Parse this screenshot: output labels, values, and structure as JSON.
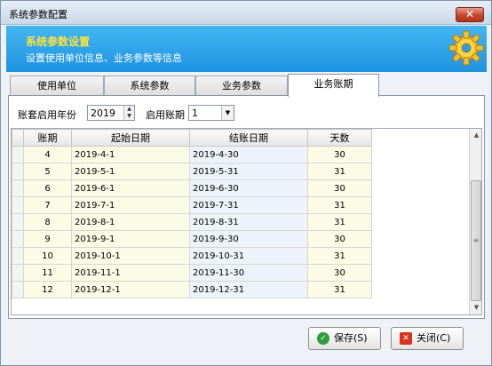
{
  "window": {
    "title": "系统参数配置",
    "close_glyph": "✕"
  },
  "banner": {
    "title": "系统参数设置",
    "subtitle": "设置使用单位信息、业务参数等信息",
    "icon": "gear-icon",
    "colors": {
      "title": "#ffe23b",
      "background": "#1e93e0"
    }
  },
  "tabs": [
    {
      "label": "使用单位",
      "active": false
    },
    {
      "label": "系统参数",
      "active": false
    },
    {
      "label": "业务参数",
      "active": false
    },
    {
      "label": "业务账期",
      "active": true
    }
  ],
  "form": {
    "year_label": "账套启用年份",
    "year_value": "2019",
    "period_label": "启用账期",
    "period_value": "1"
  },
  "grid": {
    "columns": [
      "账期",
      "起始日期",
      "结账日期",
      "天数"
    ],
    "rows": [
      [
        "4",
        "2019-4-1",
        "2019-4-30",
        "30"
      ],
      [
        "5",
        "2019-5-1",
        "2019-5-31",
        "31"
      ],
      [
        "6",
        "2019-6-1",
        "2019-6-30",
        "30"
      ],
      [
        "7",
        "2019-7-1",
        "2019-7-31",
        "31"
      ],
      [
        "8",
        "2019-8-1",
        "2019-8-31",
        "31"
      ],
      [
        "9",
        "2019-9-1",
        "2019-9-30",
        "30"
      ],
      [
        "10",
        "2019-10-1",
        "2019-10-31",
        "31"
      ],
      [
        "11",
        "2019-11-1",
        "2019-11-30",
        "30"
      ],
      [
        "12",
        "2019-12-1",
        "2019-12-31",
        "31"
      ]
    ]
  },
  "buttons": {
    "save": "保存(S)",
    "close": "关闭(C)"
  }
}
